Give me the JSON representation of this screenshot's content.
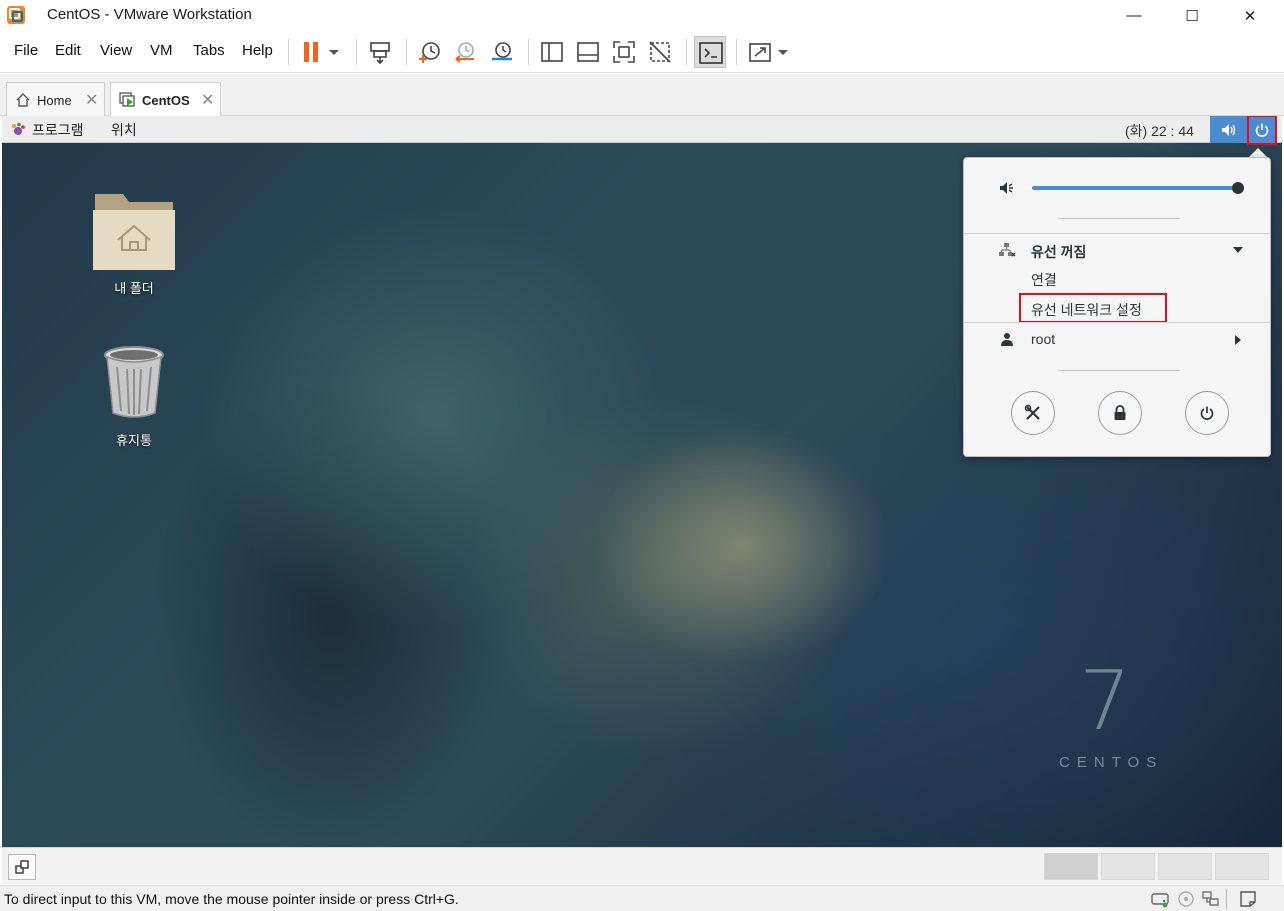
{
  "window": {
    "title": "CentOS - VMware Workstation",
    "minimize_glyph": "—",
    "maximize_glyph": "☐",
    "close_glyph": "✕"
  },
  "menu": {
    "items": [
      "File",
      "Edit",
      "View",
      "VM",
      "Tabs",
      "Help"
    ]
  },
  "toolbar": {
    "icons": [
      "pause-icon",
      "dropdown-arrow-icon",
      "send-ctrl-alt-del-icon",
      "snapshot-take-icon",
      "snapshot-revert-icon",
      "snapshot-manager-icon",
      "library-view-icon",
      "thumbnail-bar-icon",
      "full-screen-icon",
      "unity-off-icon",
      "console-view-icon",
      "stretch-view-icon",
      "dropdown-arrow-icon"
    ]
  },
  "tabs": [
    {
      "label": "Home",
      "close": "✕",
      "active": false
    },
    {
      "label": "CentOS",
      "close": "✕",
      "active": true
    }
  ],
  "gnome": {
    "apps_label": "프로그램",
    "places_label": "위치",
    "clock": "(화) 22 : 44"
  },
  "desktop": {
    "icons": [
      {
        "label": "내 폴더"
      },
      {
        "label": "휴지통"
      }
    ],
    "watermark_number": "7",
    "watermark_word": "CENTOS"
  },
  "system_menu": {
    "volume_level": 1.0,
    "wired_label": "유선 꺼짐",
    "connect_label": "연결",
    "wired_settings_label": "유선 네트워크 설정",
    "user_label": "root",
    "buttons": [
      "settings-icon",
      "lock-icon",
      "power-off-icon"
    ]
  },
  "status": {
    "text": "To direct input to this VM, move the mouse pointer inside or press Ctrl+G."
  },
  "colors": {
    "accent": "#4a8bd1",
    "highlight": "#e0101b",
    "pause": "#f0641e"
  }
}
